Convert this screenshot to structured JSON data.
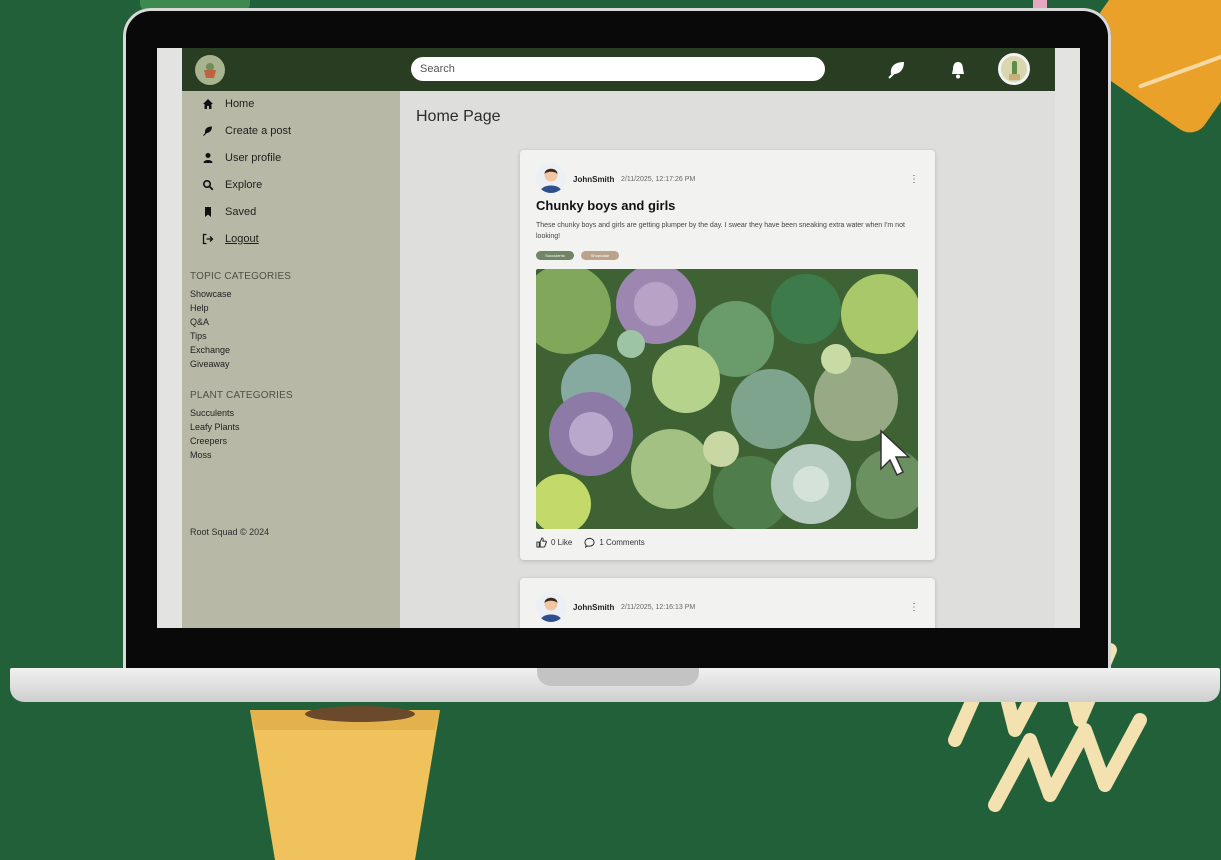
{
  "search": {
    "placeholder": "Search"
  },
  "nav": {
    "items": [
      {
        "label": "Home",
        "icon": "home-icon"
      },
      {
        "label": "Create a post",
        "icon": "leaf-icon"
      },
      {
        "label": "User profile",
        "icon": "user-icon"
      },
      {
        "label": "Explore",
        "icon": "search-icon"
      },
      {
        "label": "Saved",
        "icon": "bookmark-icon"
      },
      {
        "label": "Logout",
        "icon": "logout-icon"
      }
    ]
  },
  "topic_categories": {
    "title": "TOPIC CATEGORIES",
    "items": [
      "Showcase",
      "Help",
      "Q&A",
      "Tips",
      "Exchange",
      "Giveaway"
    ]
  },
  "plant_categories": {
    "title": "PLANT CATEGORIES",
    "items": [
      "Succulents",
      "Leafy Plants",
      "Creepers",
      "Moss"
    ]
  },
  "footer": "Root Squad © 2024",
  "main": {
    "title": "Home Page"
  },
  "posts": [
    {
      "author": "JohnSmith",
      "date": "2/11/2025, 12:17:26 PM",
      "title": "Chunky boys and girls",
      "body": "These chunky boys and girls are getting plumper by the day. I swear they have been sneaking extra water when I'm not looking!",
      "tags": [
        {
          "label": "Succulents",
          "color": "#6f8563"
        },
        {
          "label": "Showcase",
          "color": "#b9a38a"
        }
      ],
      "likes": "0 Like",
      "comments": "1 Comments"
    },
    {
      "author": "JohnSmith",
      "date": "2/11/2025, 12:16:13 PM"
    }
  ],
  "colors": {
    "background": "#22603a",
    "topbar": "#293d23",
    "sidebar": "#b7b9a6",
    "content": "#dededc"
  }
}
